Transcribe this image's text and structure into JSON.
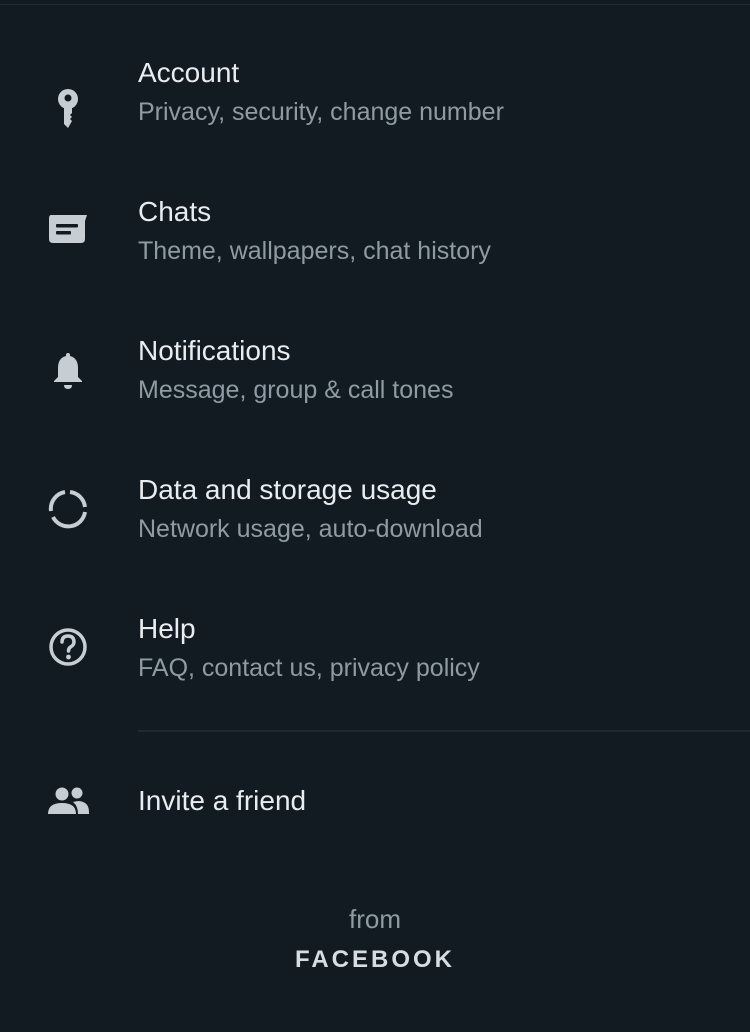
{
  "settings": {
    "items": [
      {
        "title": "Account",
        "subtitle": "Privacy, security, change number",
        "icon": "key-icon"
      },
      {
        "title": "Chats",
        "subtitle": "Theme, wallpapers, chat history",
        "icon": "chat-icon"
      },
      {
        "title": "Notifications",
        "subtitle": "Message, group & call tones",
        "icon": "bell-icon"
      },
      {
        "title": "Data and storage usage",
        "subtitle": "Network usage, auto-download",
        "icon": "data-usage-icon"
      },
      {
        "title": "Help",
        "subtitle": "FAQ, contact us, privacy policy",
        "icon": "help-icon"
      }
    ],
    "invite": {
      "title": "Invite a friend",
      "icon": "people-icon"
    }
  },
  "footer": {
    "from": "from",
    "brand": "FACEBOOK"
  },
  "colors": {
    "background": "#121b22",
    "title": "#e9edef",
    "subtitle": "#8f9ba2",
    "icon": "#c6ced3",
    "divider": "#1f2b32"
  }
}
